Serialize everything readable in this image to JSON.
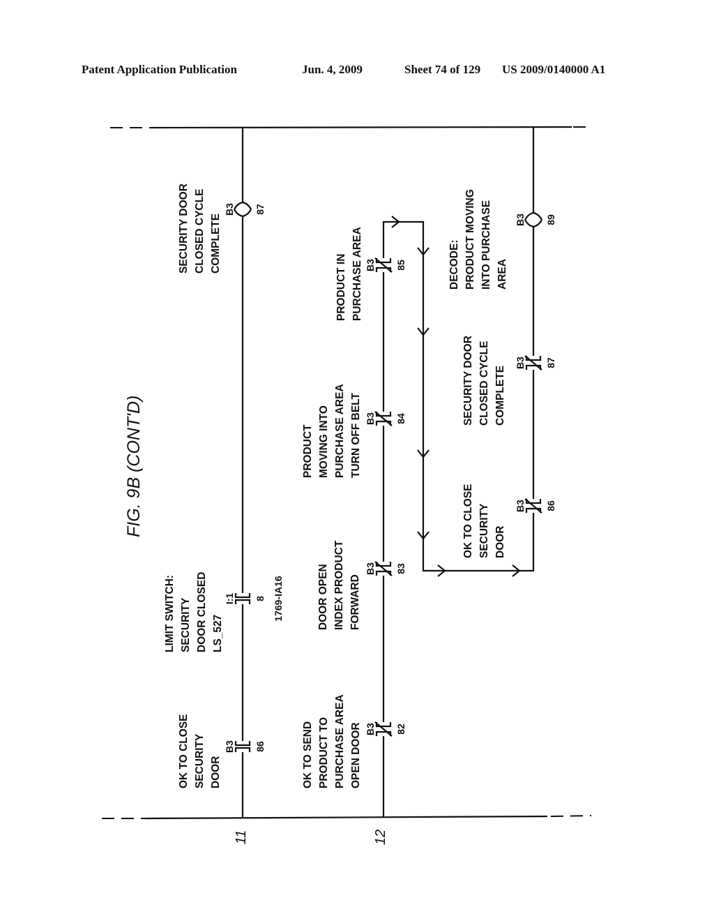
{
  "header": {
    "publication": "Patent Application Publication",
    "date": "Jun. 4, 2009",
    "sheet": "Sheet 74 of 129",
    "number": "US 2009/0140000 A1"
  },
  "figure": {
    "title": "FIG. 9B  (CONT'D)",
    "orientation": "rotated 90° counter-clockwise"
  },
  "rungs": [
    {
      "id": "11",
      "label": "11",
      "elements": [
        {
          "type": "contact-no",
          "label_lines": [
            "OK TO CLOSE",
            "SECURITY",
            "DOOR"
          ],
          "address": "B3",
          "bit": "86"
        },
        {
          "type": "contact-no",
          "label_lines": [
            "LIMIT SWITCH:",
            "SECURITY",
            "DOOR CLOSED",
            "LS_527"
          ],
          "address": "I:1",
          "bit": "8",
          "module": "1769-IA16"
        },
        {
          "type": "coil",
          "label_lines": [
            "SECURITY DOOR",
            "CLOSED CYCLE",
            "COMPLETE"
          ],
          "address": "B3",
          "bit": "87"
        }
      ]
    },
    {
      "id": "12",
      "label": "12",
      "elements": [
        {
          "type": "contact-nc",
          "label_lines": [
            "OK TO SEND",
            "PRODUCT TO",
            "PURCHASE AREA",
            "OPEN DOOR"
          ],
          "address": "B3",
          "bit": "82"
        },
        {
          "type": "contact-nc",
          "label_lines": [
            "DOOR OPEN",
            "INDEX PRODUCT",
            "FORWARD"
          ],
          "address": "B3",
          "bit": "83"
        },
        {
          "type": "contact-nc",
          "label_lines": [
            "PRODUCT",
            "MOVING INTO",
            "PURCHASE AREA",
            "TURN OFF BELT"
          ],
          "address": "B3",
          "bit": "84"
        },
        {
          "type": "contact-nc",
          "label_lines": [
            "PRODUCT IN",
            "PURCHASE AREA"
          ],
          "address": "B3",
          "bit": "85"
        }
      ],
      "continuation": [
        {
          "type": "contact-nc",
          "label_lines": [
            "OK TO CLOSE",
            "SECURITY",
            "DOOR"
          ],
          "address": "B3",
          "bit": "86"
        },
        {
          "type": "contact-nc",
          "label_lines": [
            "SECURITY DOOR",
            "CLOSED CYCLE",
            "COMPLETE"
          ],
          "address": "B3",
          "bit": "87"
        },
        {
          "type": "coil",
          "label_lines": [
            "DECODE:",
            "PRODUCT MOVING",
            "INTO PURCHASE",
            "AREA"
          ],
          "address": "B3",
          "bit": "89"
        }
      ]
    }
  ]
}
